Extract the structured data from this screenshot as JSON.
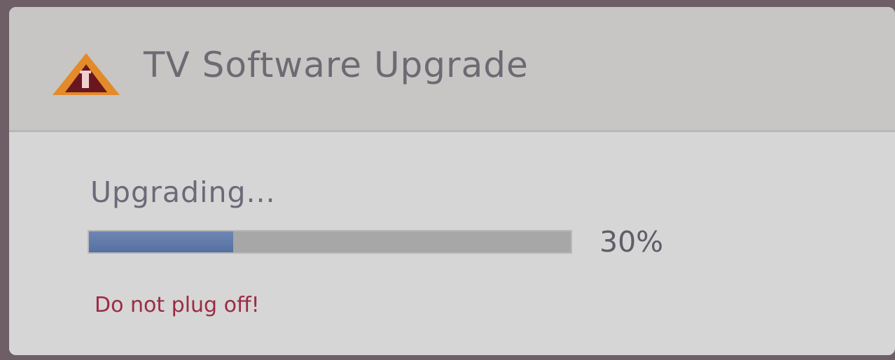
{
  "dialog": {
    "title": "TV Software Upgrade",
    "icon": "warning-triangle-icon",
    "status_text": "Upgrading...",
    "progress": {
      "value": 0.3,
      "label": "30%"
    },
    "warning_text": "Do not plug off!"
  },
  "colors": {
    "title": "#6c6b73",
    "progress_fill": "#5571a2",
    "progress_track": "#a7a7a7",
    "warning": "#9b2b44",
    "icon_orange": "#e38a2a",
    "icon_dark": "#6a1620"
  }
}
